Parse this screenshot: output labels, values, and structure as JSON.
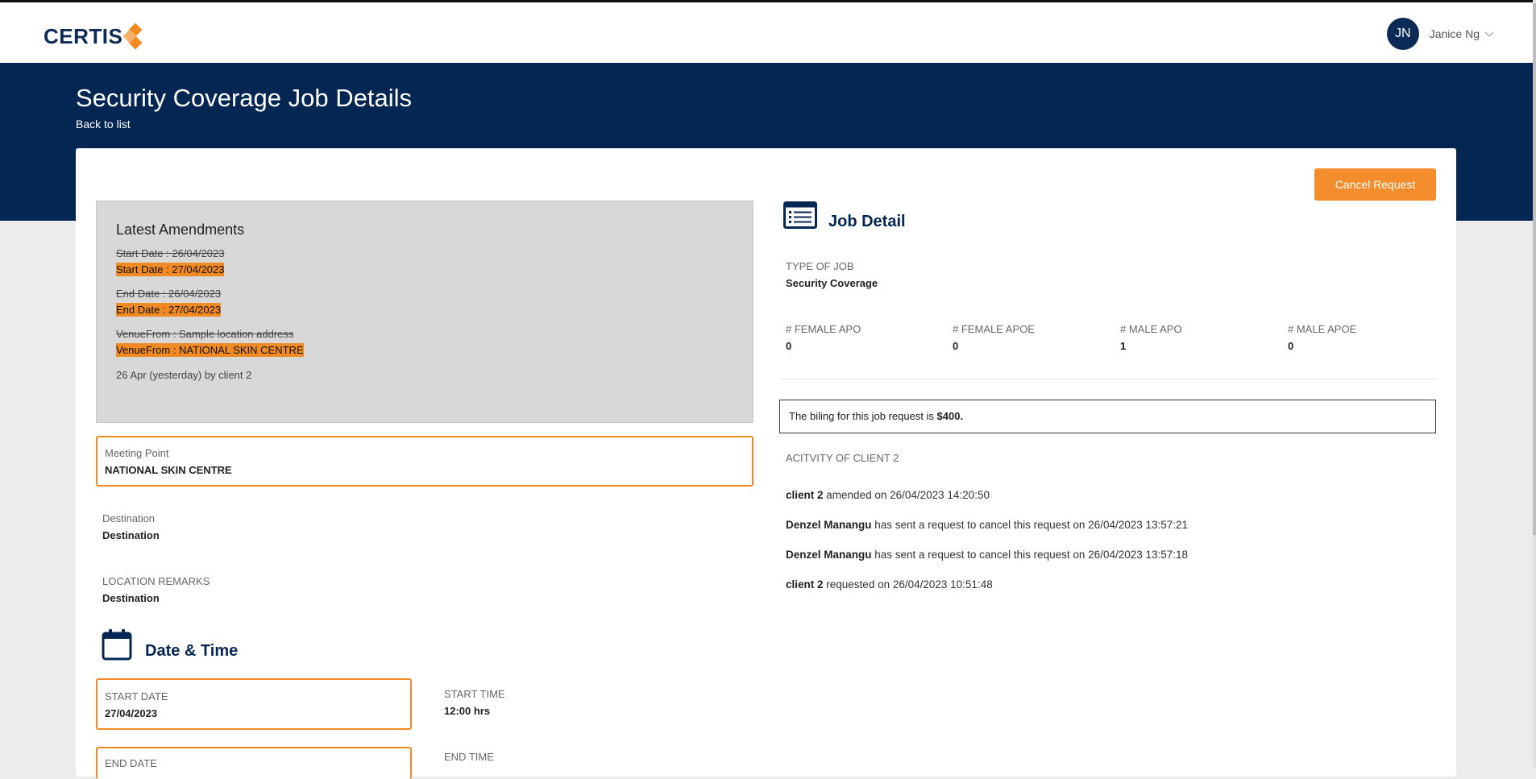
{
  "header": {
    "logo_text": "CERTIS",
    "user_initials": "JN",
    "user_name": "Janice Ng"
  },
  "page": {
    "title": "Security Coverage Job Details",
    "back_link": "Back to list",
    "cancel_button": "Cancel Request"
  },
  "amendments": {
    "title": "Latest Amendments",
    "items": [
      {
        "old": "Start Date : 26/04/2023",
        "new": "Start Date : 27/04/2023"
      },
      {
        "old": "End Date : 26/04/2023",
        "new": "End Date : 27/04/2023"
      },
      {
        "old": "VenueFrom : Sample location address",
        "new": "VenueFrom : NATIONAL SKIN CENTRE"
      }
    ],
    "by": "26 Apr (yesterday) by client 2"
  },
  "location": {
    "meeting_point_label": "Meeting Point",
    "meeting_point_value": "NATIONAL SKIN CENTRE",
    "destination_label": "Destination",
    "destination_value": "Destination",
    "remarks_label": "LOCATION REMARKS",
    "remarks_value": "Destination"
  },
  "datetime": {
    "title": "Date & Time",
    "start_date_label": "START DATE",
    "start_date_value": "27/04/2023",
    "start_time_label": "START TIME",
    "start_time_value": "12:00 hrs",
    "end_date_label": "END DATE",
    "end_time_label": "END TIME"
  },
  "job": {
    "title": "Job Detail",
    "type_label": "TYPE OF JOB",
    "type_value": "Security Coverage",
    "counts": [
      {
        "label": "# FEMALE APO",
        "value": "0"
      },
      {
        "label": "# FEMALE APOE",
        "value": "0"
      },
      {
        "label": "# MALE APO",
        "value": "1"
      },
      {
        "label": "# MALE APOE",
        "value": "0"
      }
    ],
    "billing_text": "The biling for this job request is ",
    "billing_amount": "$400.",
    "activity_label": "ACITVITY OF CLIENT 2",
    "activity": [
      {
        "actor": "client 2",
        "text": " amended on 26/04/2023 14:20:50"
      },
      {
        "actor": "Denzel Manangu",
        "text": "  has sent a request to cancel this request on 26/04/2023 13:57:21"
      },
      {
        "actor": "Denzel Manangu",
        "text": "  has sent a request to cancel this request on 26/04/2023 13:57:18"
      },
      {
        "actor": "client 2",
        "text": " requested on 26/04/2023 10:51:48"
      }
    ]
  },
  "colors": {
    "navy": "#042653",
    "orange": "#f48d2b",
    "highlight": "#f18a22"
  }
}
